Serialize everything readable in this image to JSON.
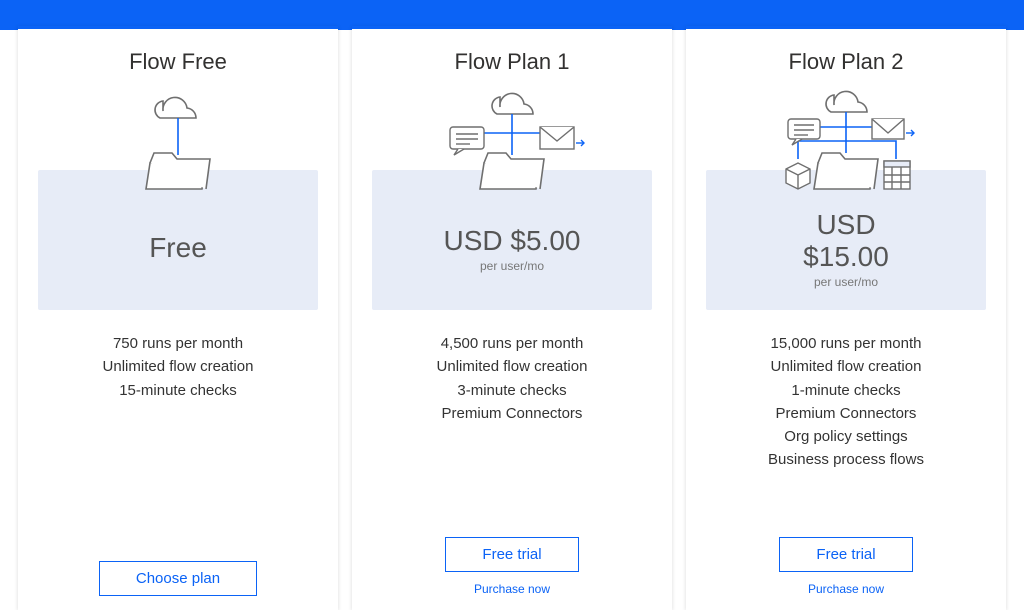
{
  "colors": {
    "accent": "#0b63f6",
    "panel": "#e7ecf7"
  },
  "plans": [
    {
      "id": "free",
      "title": "Flow Free",
      "price": "Free",
      "per": "",
      "features": [
        "750 runs per month",
        "Unlimited flow creation",
        "15-minute checks"
      ],
      "cta": "Choose plan",
      "secondary": ""
    },
    {
      "id": "plan1",
      "title": "Flow Plan 1",
      "price": "USD $5.00",
      "per": "per user/mo",
      "features": [
        "4,500 runs per month",
        "Unlimited flow creation",
        "3-minute checks",
        "Premium Connectors"
      ],
      "cta": "Free trial",
      "secondary": "Purchase now"
    },
    {
      "id": "plan2",
      "title": "Flow Plan 2",
      "price": "USD $15.00",
      "per": "per user/mo",
      "features": [
        "15,000 runs per month",
        "Unlimited flow creation",
        "1-minute checks",
        "Premium Connectors",
        "Org policy settings",
        "Business process flows"
      ],
      "cta": "Free trial",
      "secondary": "Purchase now"
    }
  ]
}
